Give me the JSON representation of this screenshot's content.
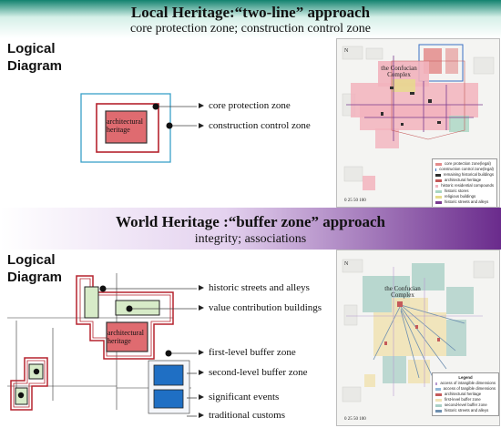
{
  "section1": {
    "title": "Local Heritage:“two-line” approach",
    "subtitle": "core protection zone; construction control zone",
    "logical_label_1": "Logical",
    "logical_label_2": "Diagram",
    "box_label_1": "architectural",
    "box_label_2": "heritage",
    "labels": [
      "core protection zone",
      "construction control zone"
    ],
    "map": {
      "block_label_1": "the Confucian",
      "block_label_2": "Complex",
      "legend": [
        {
          "label": "core protection zone(legal)",
          "color": "#e38b8b"
        },
        {
          "label": "construction control zone(legal)",
          "color": "#3a6fc4"
        },
        {
          "label": "remaining historical buildings",
          "color": "#2e2e2e"
        },
        {
          "label": "architectural heritage",
          "color": "#c45a5a"
        },
        {
          "label": "historic residential compounds",
          "color": "#f2b3bd"
        },
        {
          "label": "historic stores",
          "color": "#a9d6c2"
        },
        {
          "label": "religious buildings",
          "color": "#e6dc8a"
        },
        {
          "label": "historic streets and alleys",
          "color": "#7a3b8f"
        }
      ]
    }
  },
  "section2": {
    "title": "World Heritage :“buffer zone” approach",
    "subtitle": "integrity; associations",
    "logical_label_1": "Logical",
    "logical_label_2": "Diagram",
    "box_label_1": "architectural",
    "box_label_2": "heritage",
    "labels": [
      "historic streets and alleys",
      "value contribution buildings",
      "first-level buffer zone",
      "second-level buffer zone",
      "significant events",
      "traditional customs"
    ],
    "map": {
      "block_label_1": "the Confucian",
      "block_label_2": "Complex",
      "legend_title": "Legend",
      "legend": [
        {
          "label": "access of intangible dimensions",
          "color": "#b69ad0"
        },
        {
          "label": "access of tangible dimensions",
          "color": "#8fb6d8"
        },
        {
          "label": "architectural heritage",
          "color": "#c45a5a"
        },
        {
          "label": "first-level buffer zone",
          "color": "#f1e3b6"
        },
        {
          "label": "second-level buffer zone",
          "color": "#a9cfc6"
        },
        {
          "label": "historic streets and alleys",
          "color": "#6e8fb0"
        }
      ]
    }
  },
  "colors": {
    "heritage_fill": "#df6b70",
    "zone_red": "#b5232e",
    "zone_blue_outline": "#3aa0c8",
    "value_green": "#d7ebc8",
    "buffer_blue": "#1f6fc4"
  }
}
